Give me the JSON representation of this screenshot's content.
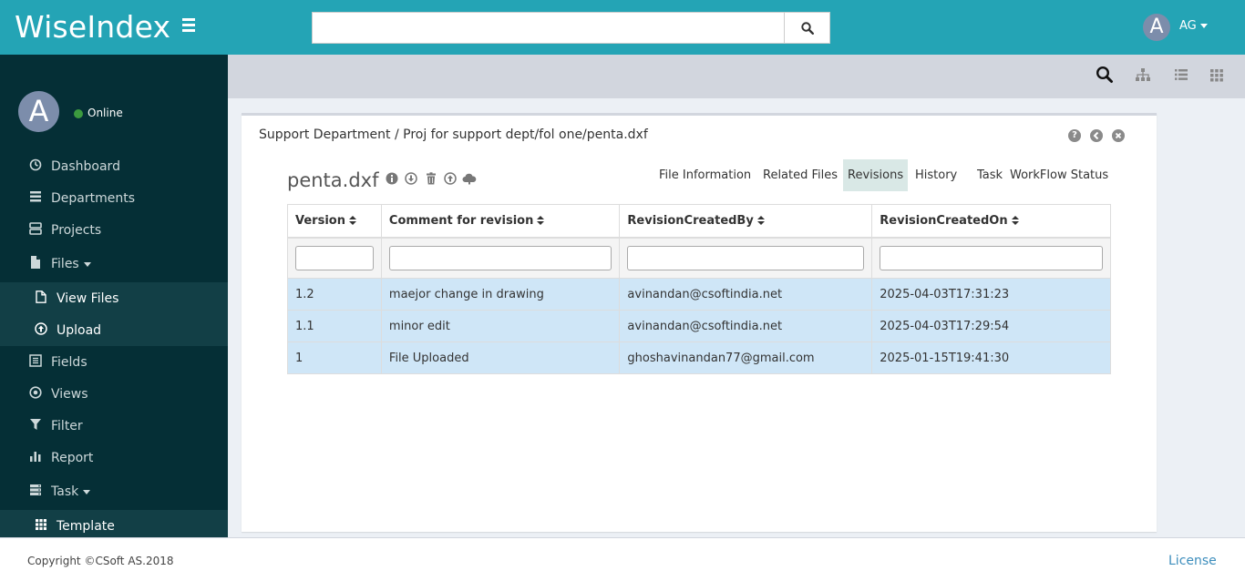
{
  "header": {
    "brand": "WiseIndex",
    "search_value": "",
    "user_initial": "A",
    "user_name": "AG"
  },
  "sidebar": {
    "avatar_initial": "A",
    "status": "Online",
    "items": [
      {
        "label": "Dashboard",
        "icon": "dashboard-icon"
      },
      {
        "label": "Departments",
        "icon": "departments-icon"
      },
      {
        "label": "Projects",
        "icon": "projects-icon"
      },
      {
        "label": "Files",
        "icon": "file-icon"
      },
      {
        "label": "View Files",
        "icon": "view-files-icon"
      },
      {
        "label": "Upload",
        "icon": "upload-icon"
      },
      {
        "label": "Fields",
        "icon": "fields-icon"
      },
      {
        "label": "Views",
        "icon": "views-icon"
      },
      {
        "label": "Filter",
        "icon": "filter-icon"
      },
      {
        "label": "Report",
        "icon": "report-icon"
      },
      {
        "label": "Task",
        "icon": "task-icon"
      },
      {
        "label": "Template",
        "icon": "template-icon"
      }
    ]
  },
  "toolbar": {
    "icons": [
      "search-icon",
      "sitemap-icon",
      "list-view-icon",
      "grid-view-icon"
    ]
  },
  "main": {
    "breadcrumb": "Support Department / Proj for support dept/fol one/penta.dxf",
    "file_name": "penta.dxf",
    "tabs": [
      {
        "label": "File Information",
        "active": false
      },
      {
        "label": "Related Files",
        "active": false
      },
      {
        "label": "Revisions",
        "active": true
      },
      {
        "label": "History",
        "active": false
      },
      {
        "label": "Task",
        "active": false
      },
      {
        "label": "WorkFlow Status",
        "active": false
      }
    ],
    "table": {
      "columns": [
        "Version",
        "Comment for revision",
        "RevisionCreatedBy",
        "RevisionCreatedOn"
      ],
      "rows": [
        [
          "1.2",
          "maejor change in drawing",
          "avinandan@csoftindia.net",
          "2025-04-03T17:31:23"
        ],
        [
          "1.1",
          "minor edit",
          "avinandan@csoftindia.net",
          "2025-04-03T17:29:54"
        ],
        [
          "1",
          "File Uploaded",
          "ghoshavinandan77@gmail.com",
          "2025-01-15T19:41:30"
        ]
      ]
    }
  },
  "footer": {
    "copyright": "Copyright ©CSoft AS.2018",
    "license": "License"
  },
  "colors": {
    "header_bg": "#24a4b5",
    "sidebar_bg": "#052f36",
    "row_highlight": "#cfe6f7",
    "active_tab": "#d9e8e6"
  }
}
